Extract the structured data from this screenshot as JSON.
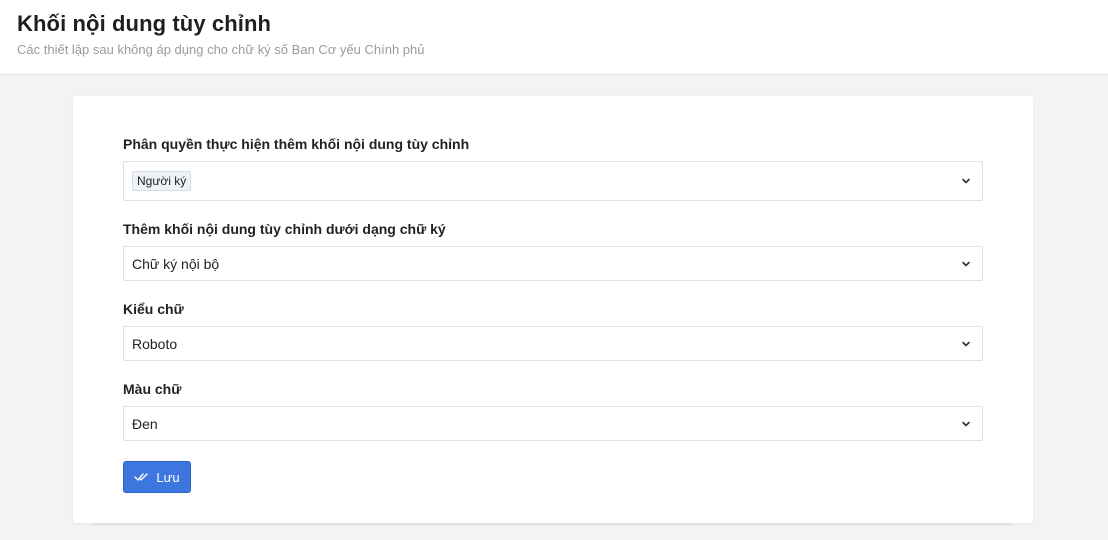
{
  "header": {
    "title": "Khối nội dung tùy chỉnh",
    "subtitle": "Các thiết lập sau không áp dụng cho chữ ký số Ban Cơ yếu Chính phủ"
  },
  "form": {
    "permission": {
      "label": "Phân quyền thực hiện thêm khối nội dung tùy chỉnh",
      "selected_tags": [
        "Người ký"
      ]
    },
    "signature_type": {
      "label": "Thêm khối nội dung tùy chỉnh dưới dạng chữ ký",
      "value": "Chữ ký nội bộ"
    },
    "font": {
      "label": "Kiểu chữ",
      "value": "Roboto"
    },
    "color": {
      "label": "Màu chữ",
      "value": "Đen"
    },
    "save_label": "Lưu"
  },
  "colors": {
    "primary": "#3d76df",
    "background": "#f3f3f3"
  },
  "icons": {
    "dropdown": "chevron-down-icon",
    "save": "double-check-icon"
  }
}
